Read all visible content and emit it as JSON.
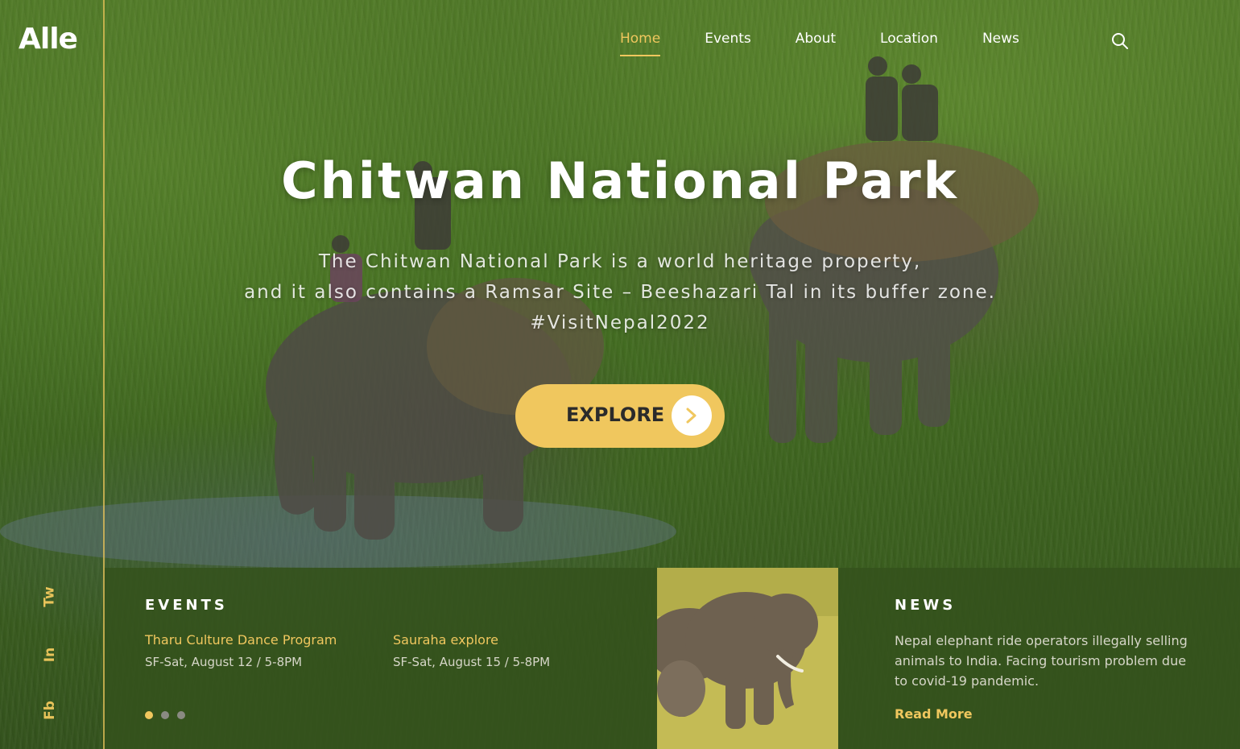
{
  "logo": "Alle",
  "nav": {
    "items": [
      {
        "label": "Home",
        "active": true
      },
      {
        "label": "Events",
        "active": false
      },
      {
        "label": "About",
        "active": false
      },
      {
        "label": "Location",
        "active": false
      },
      {
        "label": "News",
        "active": false
      }
    ],
    "search_icon": "search-icon"
  },
  "social": [
    {
      "label": "Tw"
    },
    {
      "label": "In"
    },
    {
      "label": "Fb"
    }
  ],
  "hero": {
    "title": "Chitwan National Park",
    "subtitle_line1": "The Chitwan National Park  is a world heritage property,",
    "subtitle_line2": "and it also contains a Ramsar Site – Beeshazari Tal in its buffer zone.",
    "subtitle_line3": "#VisitNepal2022",
    "button_label": "EXPLORE",
    "button_icon": "chevron-right-icon"
  },
  "events": {
    "heading": "EVENTS",
    "items": [
      {
        "title": "Tharu Culture Dance Program",
        "date": "SF-Sat, August 12 / 5-8PM"
      },
      {
        "title": "Sauraha explore",
        "date": "SF-Sat, August 15 / 5-8PM"
      }
    ],
    "pagination": {
      "count": 3,
      "active_index": 0
    }
  },
  "news": {
    "heading": "NEWS",
    "text": "Nepal elephant ride operators illegally selling animals to India. Facing tourism problem due to covid-19 pandemic.",
    "link": "Read More"
  },
  "colors": {
    "accent": "#f0c75e",
    "panel": "#34521c",
    "text_light": "#ffffff"
  }
}
